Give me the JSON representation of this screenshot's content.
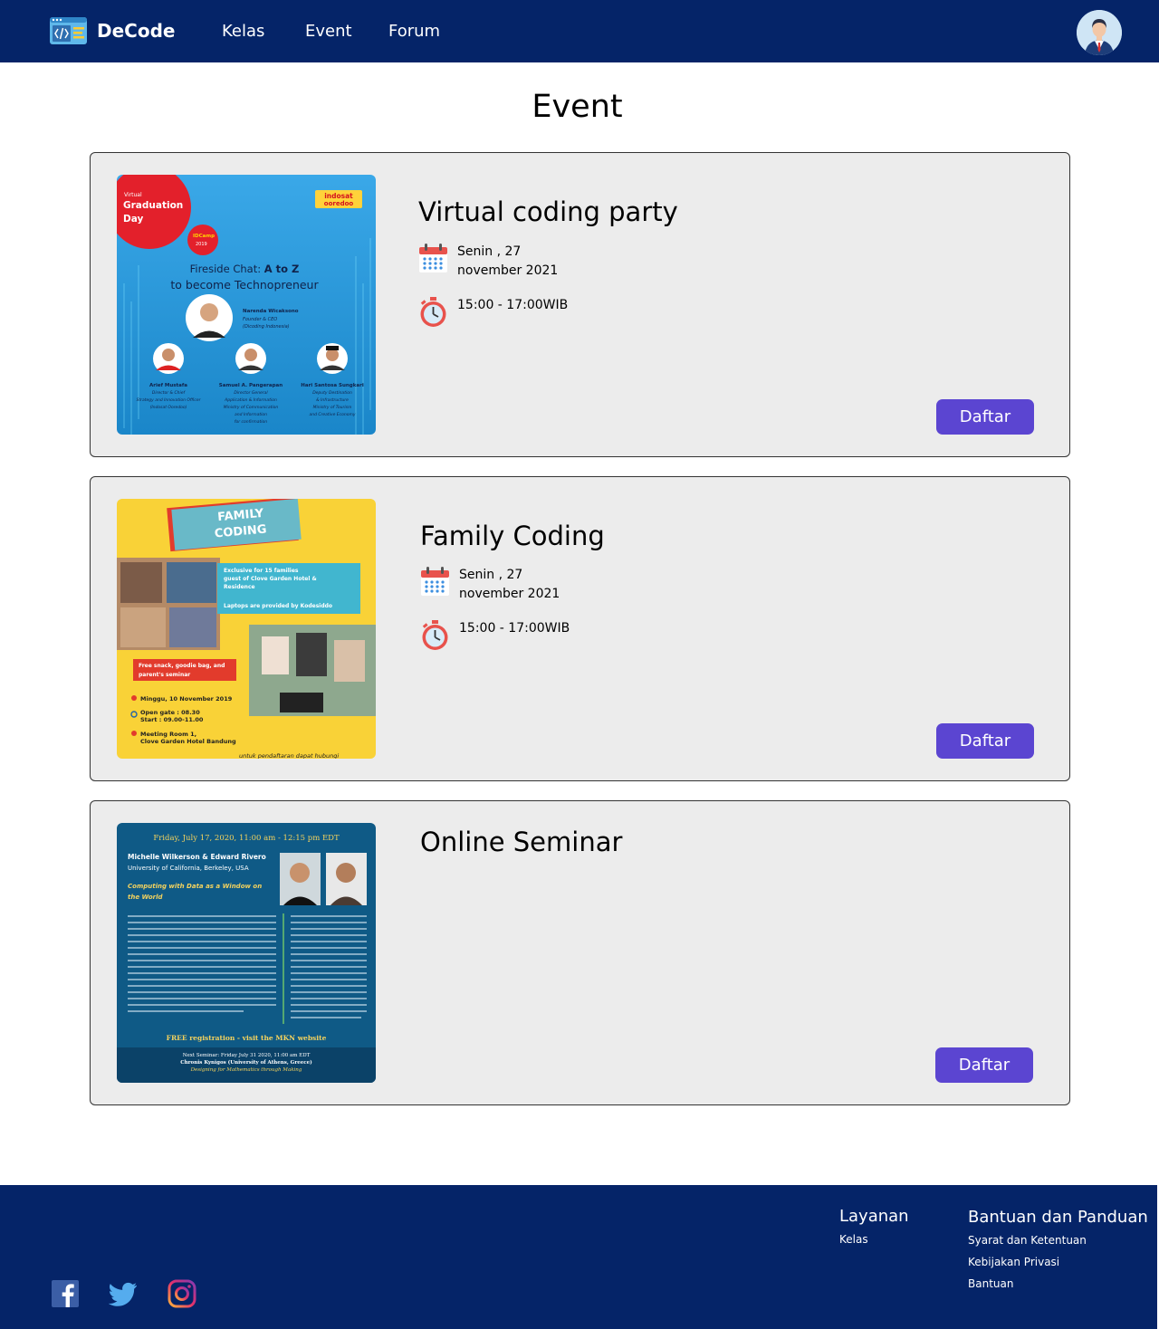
{
  "brand": {
    "name": "DeCode"
  },
  "nav": {
    "items": [
      "Kelas",
      "Event",
      "Forum"
    ]
  },
  "page": {
    "title": "Event"
  },
  "events": [
    {
      "title": "Virtual coding party",
      "date": "Senin , 27 november 2021",
      "time": "15:00 - 17:00WIB",
      "button": "Daftar",
      "poster": {
        "badge": "Virtual Graduation Day",
        "sponsor": "indosat ooredoo",
        "camp": "IDCamp 2019",
        "headline": "Fireside Chat: A to Z",
        "subline": "to become Technopreneur",
        "host_name": "Narenda Wicaksono",
        "host_role": "Founder & CEO",
        "speakers": [
          "Arief Mustafa",
          "Samuel A. Pangerapan",
          "Hari Santosa Sungkari"
        ]
      }
    },
    {
      "title": "Family Coding",
      "date": "Senin , 27 november 2021",
      "time": "15:00 - 17:00WIB",
      "button": "Daftar",
      "poster": {
        "headline": "FAMILY CODING",
        "box1": "Exclusive for 15 families guest of Clove Garden Hotel & Residence",
        "box2": "Laptops are provided by Kodesiddo",
        "free": "Free snack, goodie bag, and parent's seminar",
        "date": "Minggu, 10 November 2019",
        "gate": "Open gate : 08.30",
        "start": "Start : 09.00-11.00",
        "place": "Meeting Room 1, Clove Garden Hotel Bandung",
        "footer": "untuk pendaftaran dapat hubungi"
      }
    },
    {
      "title": "Online Seminar",
      "button": "Daftar",
      "poster": {
        "date": "Friday, July 17, 2020, 11:00 am - 12:15 pm EDT",
        "speakers": "Michelle Wilkerson & Edward Rivero",
        "org": "University of California, Berkeley, USA",
        "talk": "Computing with Data as a Window on the World",
        "reg": "FREE registration - visit the MKN website",
        "next": "Next Seminar: Friday July 31 2020, 11:00 am EDT",
        "next_name": "Chronis Kynigos (University of Athens, Greece)",
        "next_talk": "Designing for Mathematics through Making"
      }
    }
  ],
  "footer": {
    "layanan": {
      "title": "Layanan",
      "links": [
        "Kelas"
      ]
    },
    "bantuan": {
      "title": "Bantuan dan Panduan",
      "links": [
        "Syarat dan Ketentuan",
        "Kebijakan Privasi",
        "Bantuan"
      ]
    },
    "social": [
      "facebook-icon",
      "twitter-icon",
      "instagram-icon"
    ]
  },
  "colors": {
    "navy": "#052468",
    "button": "#5b45d1",
    "card": "#ececec"
  }
}
